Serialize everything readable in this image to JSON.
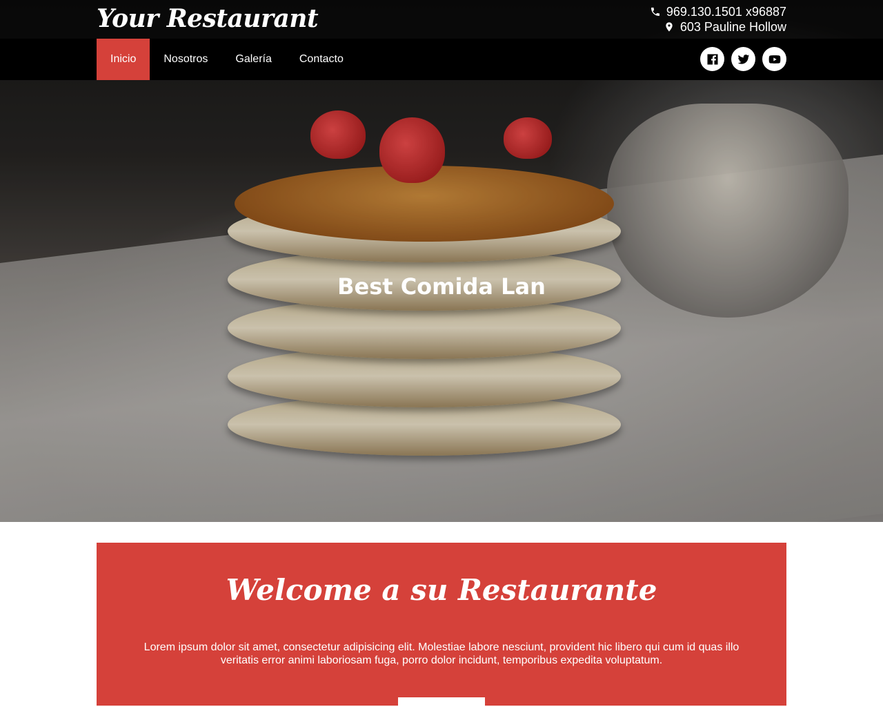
{
  "header": {
    "brand": "Your Restaurant",
    "phone": "969.130.1501 x96887",
    "address": "603 Pauline Hollow"
  },
  "nav": {
    "items": [
      {
        "label": "Inicio",
        "active": true
      },
      {
        "label": "Nosotros",
        "active": false
      },
      {
        "label": "Galería",
        "active": false
      },
      {
        "label": "Contacto",
        "active": false
      }
    ]
  },
  "social": [
    "facebook-icon",
    "twitter-icon",
    "youtube-icon"
  ],
  "hero": {
    "title": "Best Comida Lan"
  },
  "welcome": {
    "title": "Welcome a su Restaurante",
    "text": "Lorem ipsum dolor sit amet, consectetur adipisicing elit. Molestiae labore nesciunt, provident hic libero qui cum id quas illo veritatis error animi laboriosam fuga, porro dolor incidunt, temporibus expedita voluptatum."
  },
  "colors": {
    "accent": "#d5413a",
    "navbar": "#000000",
    "text_light": "#ffffff"
  }
}
